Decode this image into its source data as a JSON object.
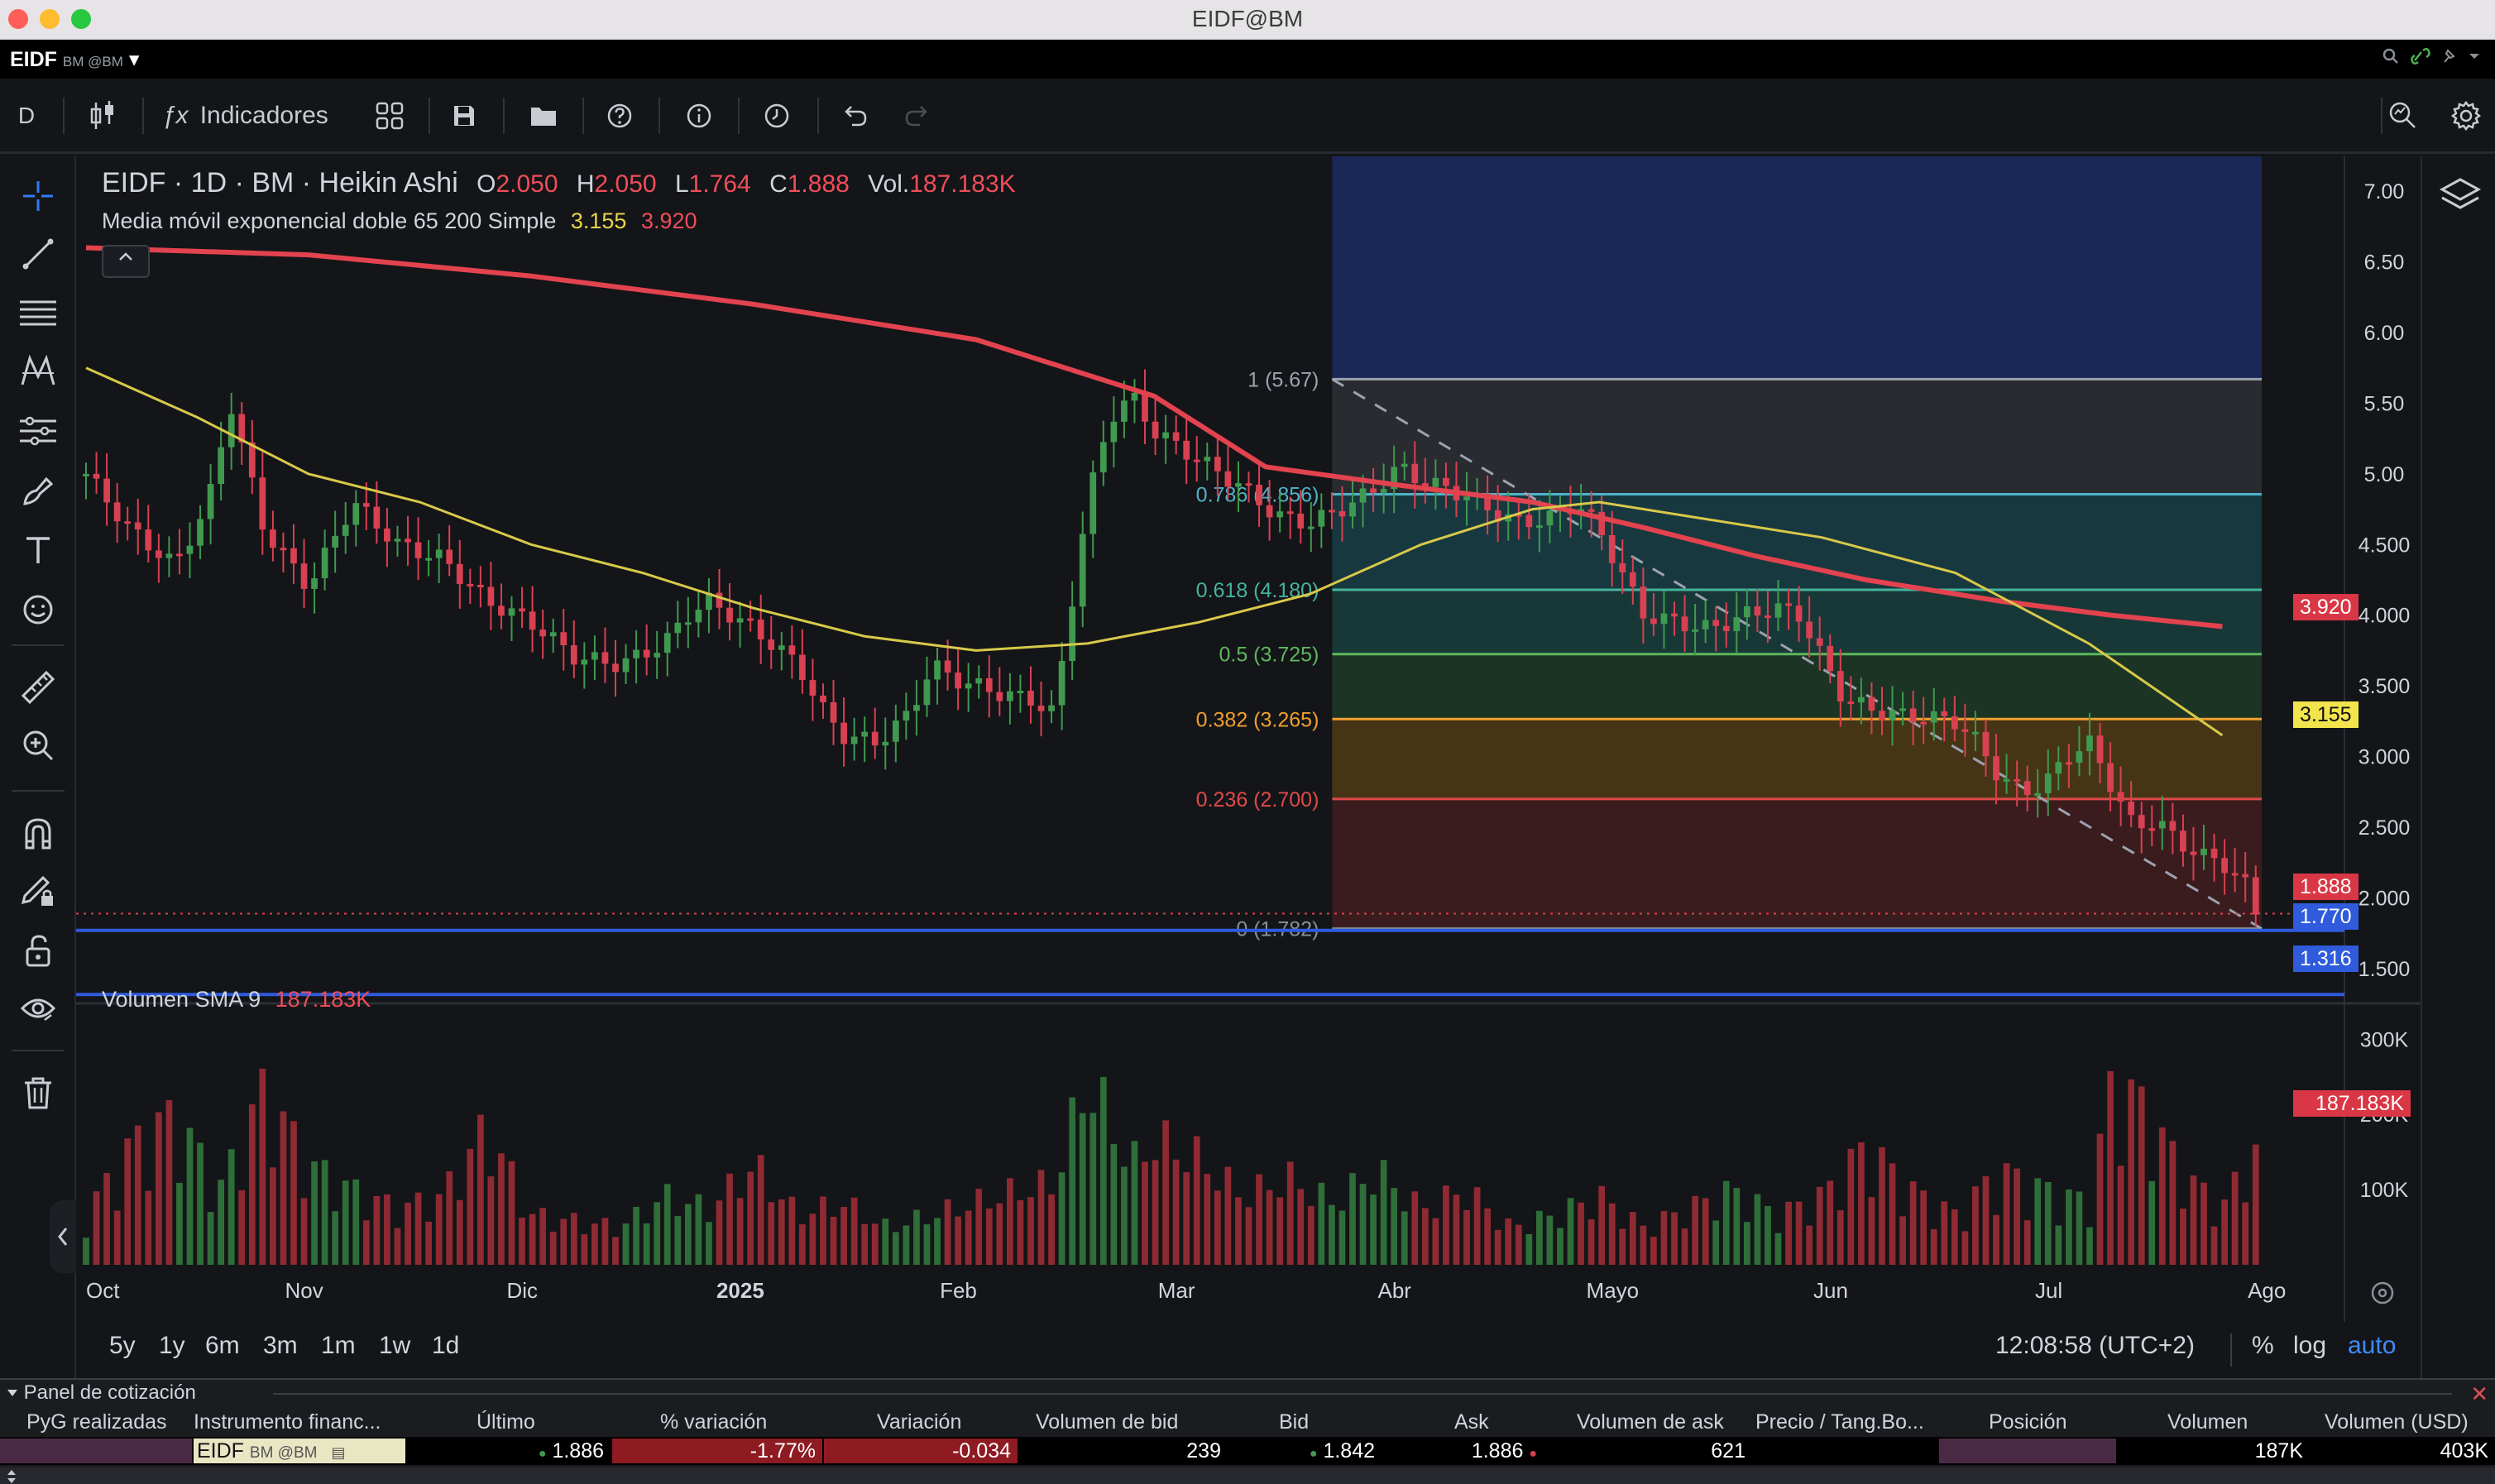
{
  "window": {
    "title": "EIDF@BM"
  },
  "symbolbar": {
    "symbol": "EIDF",
    "exchange": "BM @BM",
    "dropdown": "▾"
  },
  "toolbar": {
    "interval": "D",
    "indicators_label": "Indicadores",
    "indicators_glyph": "ƒx"
  },
  "chart_info": {
    "title": "EIDF · 1D · BM · Heikin Ashi",
    "o_label": "O",
    "o_value": "2.050",
    "h_label": "H",
    "h_value": "2.050",
    "l_label": "L",
    "l_value": "1.764",
    "c_label": "C",
    "c_value": "1.888",
    "vol_label": "Vol.",
    "vol_value": "187.183K",
    "ma_label": "Media móvil exponencial doble 65 200 Simple",
    "ma_value_1": "3.155",
    "ma_value_2": "3.920",
    "volume_label": "Volumen SMA 9",
    "volume_value": "187.183K"
  },
  "price_tags": {
    "ema200": "3.920",
    "ema65": "3.155",
    "last": "1.888",
    "hline1": "1.770",
    "hline2": "1.316",
    "volume": "187.183K"
  },
  "colors": {
    "up": "#3f9a4f",
    "down": "#d84152",
    "ema_long": "#e2434f",
    "ema_short": "#d8c94a",
    "hline": "#2f5bdc"
  },
  "chart_data": {
    "type": "candlestick",
    "style": "Heikin Ashi",
    "price_axis": [
      "7.00",
      "6.50",
      "6.00",
      "5.50",
      "5.00",
      "4.500",
      "4.000",
      "3.500",
      "3.000",
      "2.500",
      "2.000",
      "1.500"
    ],
    "price_range": [
      1.3,
      7.2
    ],
    "x_labels": [
      "Oct",
      "Nov",
      "Dic",
      "2025",
      "Feb",
      "Mar",
      "Abr",
      "Mayo",
      "Jun",
      "Jul",
      "Ago"
    ],
    "volume_axis": [
      "300K",
      "200K",
      "100K"
    ],
    "fibonacci": [
      {
        "label": "1 (5.67)",
        "value": 5.67,
        "color": "#9ca3af"
      },
      {
        "label": "0.786 (4.856)",
        "value": 4.856,
        "color": "#4fb3c9"
      },
      {
        "label": "0.618 (4.180)",
        "value": 4.18,
        "color": "#45b39d"
      },
      {
        "label": "0.5 (3.725)",
        "value": 3.725,
        "color": "#5cb85c"
      },
      {
        "label": "0.382 (3.265)",
        "value": 3.265,
        "color": "#f0a030"
      },
      {
        "label": "0.236 (2.700)",
        "value": 2.7,
        "color": "#e04a4a"
      },
      {
        "label": "0 (1.782)",
        "value": 1.782,
        "color": "#8a8f98"
      }
    ],
    "horizontal_lines": [
      1.77,
      1.316
    ],
    "series": [
      {
        "name": "Media móvil exponencial doble 65 200 Simple",
        "kind": "ema_long",
        "points": [
          [
            0,
            6.6
          ],
          [
            0.1,
            6.55
          ],
          [
            0.2,
            6.4
          ],
          [
            0.3,
            6.2
          ],
          [
            0.4,
            5.95
          ],
          [
            0.48,
            5.55
          ],
          [
            0.53,
            5.05
          ],
          [
            0.59,
            4.92
          ],
          [
            0.65,
            4.8
          ],
          [
            0.7,
            4.62
          ],
          [
            0.75,
            4.42
          ],
          [
            0.8,
            4.25
          ],
          [
            0.86,
            4.1
          ],
          [
            0.91,
            4.0
          ],
          [
            0.96,
            3.92
          ]
        ]
      },
      {
        "name": "Media móvil exponencial doble 65 200 Simple",
        "kind": "ema_short",
        "points": [
          [
            0,
            5.75
          ],
          [
            0.05,
            5.4
          ],
          [
            0.1,
            5.0
          ],
          [
            0.15,
            4.8
          ],
          [
            0.2,
            4.5
          ],
          [
            0.25,
            4.3
          ],
          [
            0.3,
            4.05
          ],
          [
            0.35,
            3.85
          ],
          [
            0.4,
            3.75
          ],
          [
            0.45,
            3.8
          ],
          [
            0.5,
            3.95
          ],
          [
            0.55,
            4.15
          ],
          [
            0.6,
            4.5
          ],
          [
            0.65,
            4.75
          ],
          [
            0.68,
            4.8
          ],
          [
            0.72,
            4.7
          ],
          [
            0.78,
            4.55
          ],
          [
            0.84,
            4.3
          ],
          [
            0.9,
            3.8
          ],
          [
            0.96,
            3.15
          ]
        ]
      },
      {
        "name": "Heikin Ashi",
        "kind": "candles",
        "points": [
          [
            0,
            5.0
          ],
          [
            0.02,
            4.6
          ],
          [
            0.04,
            4.35
          ],
          [
            0.055,
            4.8
          ],
          [
            0.065,
            5.5
          ],
          [
            0.08,
            4.6
          ],
          [
            0.1,
            4.2
          ],
          [
            0.12,
            4.8
          ],
          [
            0.14,
            4.5
          ],
          [
            0.16,
            4.4
          ],
          [
            0.18,
            4.1
          ],
          [
            0.2,
            3.95
          ],
          [
            0.22,
            3.7
          ],
          [
            0.24,
            3.65
          ],
          [
            0.26,
            3.8
          ],
          [
            0.27,
            4.0
          ],
          [
            0.28,
            4.1
          ],
          [
            0.3,
            3.9
          ],
          [
            0.32,
            3.65
          ],
          [
            0.33,
            3.35
          ],
          [
            0.34,
            3.15
          ],
          [
            0.355,
            3.1
          ],
          [
            0.37,
            3.3
          ],
          [
            0.38,
            3.65
          ],
          [
            0.39,
            3.55
          ],
          [
            0.41,
            3.45
          ],
          [
            0.425,
            3.4
          ],
          [
            0.435,
            3.3
          ],
          [
            0.44,
            3.8
          ],
          [
            0.45,
            4.8
          ],
          [
            0.46,
            5.4
          ],
          [
            0.47,
            5.55
          ],
          [
            0.48,
            5.3
          ],
          [
            0.5,
            5.1
          ],
          [
            0.52,
            4.9
          ],
          [
            0.535,
            4.7
          ],
          [
            0.55,
            4.65
          ],
          [
            0.57,
            4.8
          ],
          [
            0.58,
            4.9
          ],
          [
            0.59,
            5.05
          ],
          [
            0.6,
            4.95
          ],
          [
            0.62,
            4.85
          ],
          [
            0.63,
            4.75
          ],
          [
            0.645,
            4.65
          ],
          [
            0.66,
            4.7
          ],
          [
            0.67,
            4.8
          ],
          [
            0.68,
            4.6
          ],
          [
            0.69,
            4.3
          ],
          [
            0.7,
            4.0
          ],
          [
            0.715,
            3.95
          ],
          [
            0.73,
            3.9
          ],
          [
            0.745,
            4.0
          ],
          [
            0.76,
            4.05
          ],
          [
            0.77,
            4.0
          ],
          [
            0.78,
            3.7
          ],
          [
            0.79,
            3.4
          ],
          [
            0.8,
            3.35
          ],
          [
            0.81,
            3.3
          ],
          [
            0.825,
            3.28
          ],
          [
            0.84,
            3.25
          ],
          [
            0.85,
            3.1
          ],
          [
            0.86,
            2.85
          ],
          [
            0.87,
            2.75
          ],
          [
            0.88,
            2.8
          ],
          [
            0.89,
            3.0
          ],
          [
            0.9,
            3.1
          ],
          [
            0.91,
            2.8
          ],
          [
            0.92,
            2.5
          ],
          [
            0.93,
            2.55
          ],
          [
            0.94,
            2.4
          ],
          [
            0.95,
            2.3
          ],
          [
            0.96,
            2.25
          ],
          [
            0.97,
            2.1
          ],
          [
            0.975,
            1.9
          ]
        ]
      }
    ],
    "volume_series": [
      [
        0,
        80
      ],
      [
        0.02,
        190
      ],
      [
        0.04,
        240
      ],
      [
        0.06,
        120
      ],
      [
        0.08,
        280
      ],
      [
        0.1,
        160
      ],
      [
        0.12,
        120
      ],
      [
        0.14,
        90
      ],
      [
        0.16,
        110
      ],
      [
        0.18,
        220
      ],
      [
        0.2,
        80
      ],
      [
        0.22,
        70
      ],
      [
        0.24,
        60
      ],
      [
        0.26,
        110
      ],
      [
        0.28,
        90
      ],
      [
        0.3,
        160
      ],
      [
        0.32,
        80
      ],
      [
        0.34,
        100
      ],
      [
        0.36,
        60
      ],
      [
        0.38,
        80
      ],
      [
        0.4,
        100
      ],
      [
        0.42,
        120
      ],
      [
        0.435,
        130
      ],
      [
        0.45,
        300
      ],
      [
        0.46,
        230
      ],
      [
        0.47,
        160
      ],
      [
        0.48,
        200
      ],
      [
        0.5,
        170
      ],
      [
        0.52,
        110
      ],
      [
        0.54,
        140
      ],
      [
        0.56,
        100
      ],
      [
        0.58,
        150
      ],
      [
        0.6,
        90
      ],
      [
        0.62,
        120
      ],
      [
        0.64,
        60
      ],
      [
        0.66,
        80
      ],
      [
        0.68,
        110
      ],
      [
        0.7,
        60
      ],
      [
        0.72,
        90
      ],
      [
        0.74,
        120
      ],
      [
        0.76,
        80
      ],
      [
        0.78,
        110
      ],
      [
        0.8,
        190
      ],
      [
        0.82,
        120
      ],
      [
        0.84,
        80
      ],
      [
        0.86,
        150
      ],
      [
        0.88,
        120
      ],
      [
        0.9,
        100
      ],
      [
        0.91,
        280
      ],
      [
        0.92,
        270
      ],
      [
        0.93,
        220
      ],
      [
        0.94,
        160
      ],
      [
        0.95,
        120
      ],
      [
        0.96,
        90
      ],
      [
        0.97,
        160
      ],
      [
        0.98,
        200
      ]
    ],
    "grid": false,
    "legend": "top-left"
  },
  "range_bar": {
    "ranges": [
      "5y",
      "1y",
      "6m",
      "3m",
      "1m",
      "1w",
      "1d"
    ],
    "time": "12:08:58 (UTC+2)",
    "percent": "%",
    "log": "log",
    "auto": "auto"
  },
  "quote_panel": {
    "title": "Panel de cotización",
    "columns": [
      "PyG realizadas",
      "Instrumento financ...",
      "Último",
      "% variación",
      "Variación",
      "Volumen de bid",
      "Bid",
      "Ask",
      "Volumen de ask",
      "Precio / Tang.Bo...",
      "Posición",
      "Volumen",
      "Volumen (USD)"
    ],
    "row": {
      "instrument": "EIDF",
      "exchange": "BM @BM",
      "last": "1.886",
      "pct_change": "-1.77%",
      "change": "-0.034",
      "bid_volume": "239",
      "bid": "1.842",
      "ask": "1.886",
      "ask_volume": "621",
      "volume": "187K",
      "volume_usd": "403K"
    }
  }
}
